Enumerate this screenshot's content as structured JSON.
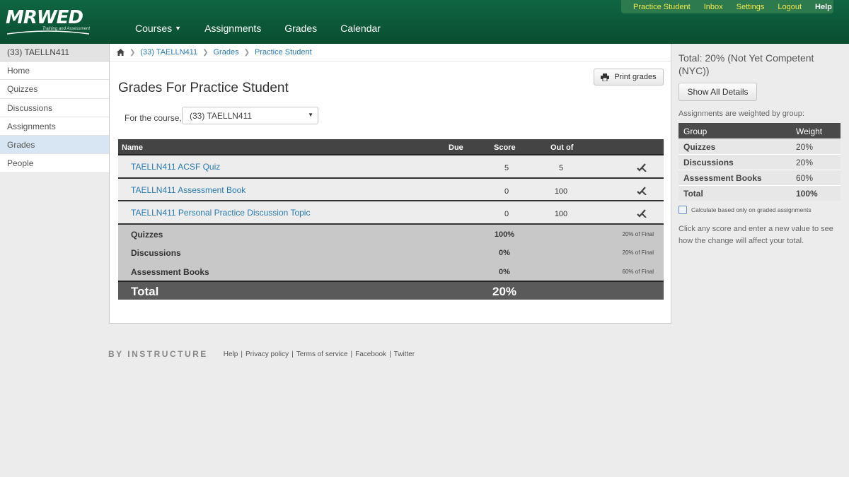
{
  "brand": {
    "logo_text": "MRWED",
    "logo_sub": "Training and Assessment"
  },
  "main_nav": [
    {
      "label": "Courses",
      "has_dropdown": true
    },
    {
      "label": "Assignments"
    },
    {
      "label": "Grades"
    },
    {
      "label": "Calendar"
    }
  ],
  "user_nav": {
    "user": "Practice Student",
    "inbox": "Inbox",
    "settings": "Settings",
    "logout": "Logout",
    "help": "Help"
  },
  "sidebar": {
    "course_title": "(33) TAELLN411",
    "items": [
      {
        "label": "Home"
      },
      {
        "label": "Quizzes"
      },
      {
        "label": "Discussions"
      },
      {
        "label": "Assignments"
      },
      {
        "label": "Grades",
        "active": true
      },
      {
        "label": "People"
      }
    ]
  },
  "breadcrumb": {
    "course": "(33) TAELLN411",
    "grades": "Grades",
    "student": "Practice Student"
  },
  "page": {
    "print_label": "Print grades",
    "title": "Grades For Practice Student",
    "course_select_label": "For the course,",
    "course_select_value": "(33) TAELLN411"
  },
  "grades_table": {
    "headers": {
      "name": "Name",
      "due": "Due",
      "score": "Score",
      "out_of": "Out of"
    },
    "assignments": [
      {
        "name": "TAELLN411 ACSF Quiz",
        "score": "5",
        "out_of": "5"
      },
      {
        "name": "TAELLN411 Assessment Book",
        "score": "0",
        "out_of": "100"
      },
      {
        "name": "TAELLN411 Personal Practice Discussion Topic",
        "score": "0",
        "out_of": "100"
      }
    ],
    "groups": [
      {
        "name": "Quizzes",
        "percent": "100%",
        "weight": "20% of Final"
      },
      {
        "name": "Discussions",
        "percent": "0%",
        "weight": "20% of Final"
      },
      {
        "name": "Assessment Books",
        "percent": "0%",
        "weight": "60% of Final"
      }
    ],
    "total_label": "Total",
    "total_value": "20%"
  },
  "footer": {
    "brand": "BY INSTRUCTURE",
    "links": [
      "Help",
      "Privacy policy",
      "Terms of service",
      "Facebook",
      "Twitter"
    ]
  },
  "right_side": {
    "total": "Total: 20% (Not Yet Competent (NYC))",
    "show_details": "Show All Details",
    "weighted_note": "Assignments are weighted by group:",
    "weights_header": {
      "group": "Group",
      "weight": "Weight"
    },
    "weights": [
      {
        "group": "Quizzes",
        "weight": "20%"
      },
      {
        "group": "Discussions",
        "weight": "20%"
      },
      {
        "group": "Assessment Books",
        "weight": "60%"
      },
      {
        "group": "Total",
        "weight": "100%"
      }
    ],
    "checkbox_label": "Calculate based only on graded assignments",
    "click_note": "Click any score and enter a new value to see how the change will affect your total."
  },
  "colors": {
    "header": "#0d5a3a",
    "user_nav_bg": "#2d7a4e",
    "user_link": "#f2e84b",
    "link": "#2a7ab0"
  }
}
